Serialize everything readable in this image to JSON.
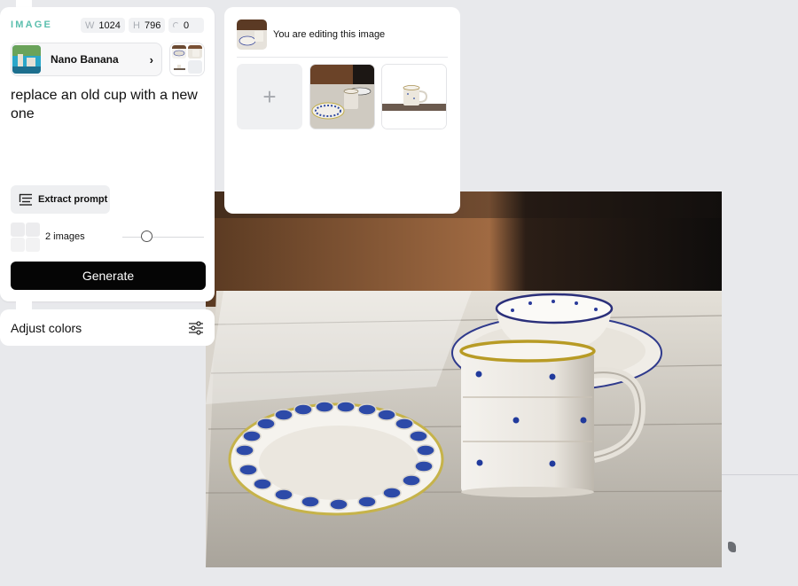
{
  "image_panel": {
    "label": "IMAGE",
    "width_key": "W",
    "width_value": "1024",
    "height_key": "H",
    "height_value": "796",
    "seed_value": "0"
  },
  "model": {
    "name": "Nano Banana",
    "chevron": "›"
  },
  "prompt": "replace an old cup with a new one",
  "extract_prompt_label": "Extract prompt",
  "image_count_label": "2 images",
  "image_count_slider_fraction": 0.3,
  "generate_label": "Generate",
  "adjust_colors_label": "Adjust colors",
  "editing": {
    "title": "You are editing this image",
    "add_symbol": "+"
  },
  "colors": {
    "accent": "#5bbfae",
    "generate_bg": "#050505",
    "canvas_bg": "#e8e9ec"
  },
  "icons": {
    "extract": "text-align-icon",
    "adjust": "sliders-icon",
    "chevron": "chevron-right-icon"
  }
}
